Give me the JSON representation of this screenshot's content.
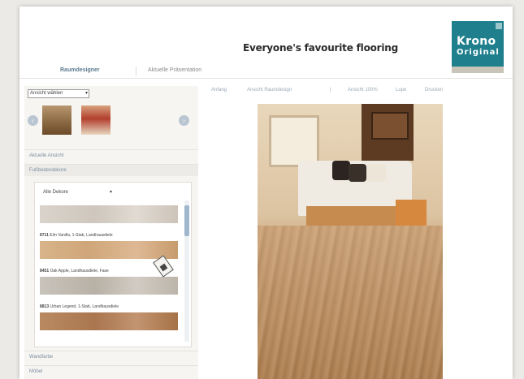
{
  "header": {
    "title": "Everyone's favourite flooring",
    "logo": {
      "line1": "Krono",
      "line2": "Original"
    }
  },
  "tabs": [
    {
      "label": "Raumdesigner",
      "active": true
    },
    {
      "label": "Aktuelle Präsentation",
      "active": false
    }
  ],
  "sidebar": {
    "view_select": "Ansicht wählen",
    "room_nav": {
      "prev_icon": "chevron-left-icon",
      "next_icon": "chevron-right-icon"
    },
    "sections": {
      "room_view": "Aktuelle Ansicht",
      "floor_decors": "Fußbodendekore",
      "walls": "Wandfarbe",
      "furniture": "Möbel"
    },
    "decor_select": "Alle Dekore",
    "decors": [
      {
        "code": "8711",
        "name": "Elm Vanilla, 1-Stab, Landhausdiele"
      },
      {
        "code": "8451",
        "name": "Oak Apple, Landhausdiele, Fase"
      },
      {
        "code": "8813",
        "name": "Urban Legend, 1-Stab, Landhausdiele"
      }
    ]
  },
  "toolbar": {
    "items": [
      "Anfang",
      "Ansicht Raumdesign",
      "",
      "Ansicht 100%",
      "Lupe",
      "Drucken"
    ]
  },
  "colors": {
    "accent": "#1f7f8d",
    "tab_active": "#5b7a8e",
    "nav_button": "#b9c6d2",
    "scroll_thumb": "#9fb6cc"
  }
}
